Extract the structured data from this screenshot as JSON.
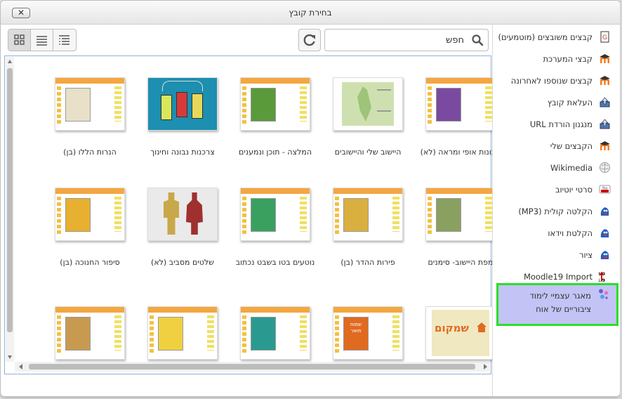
{
  "dialog": {
    "title": "בחירת קובץ",
    "close_label": "✕"
  },
  "search": {
    "placeholder": "חפש",
    "value": ""
  },
  "view_modes": [
    "icons",
    "list",
    "tree"
  ],
  "sidebar": {
    "items": [
      {
        "label": "קבצים משובצים (מוטמעים)",
        "icon": "embedded-files-icon",
        "color": "#c0392b"
      },
      {
        "label": "קבצי המערכת",
        "icon": "moodle-icon",
        "color": "#f47b20"
      },
      {
        "label": "קבצים שנוספו לאחרונה",
        "icon": "moodle-icon",
        "color": "#f47b20"
      },
      {
        "label": "העלאת קובץ",
        "icon": "upload-icon",
        "color": "#4a7ab5"
      },
      {
        "label": "מנגנון הורדת URL",
        "icon": "url-download-icon",
        "color": "#4a7ab5"
      },
      {
        "label": "הקבצים שלי",
        "icon": "moodle-icon",
        "color": "#f47b20"
      },
      {
        "label": "Wikimedia",
        "icon": "wikimedia-icon",
        "color": "#888888"
      },
      {
        "label": "סרטי יוטיוב",
        "icon": "youtube-icon",
        "color": "#cc0000"
      },
      {
        "label": "הקלטה קולית (MP3)",
        "icon": "poodll-icon",
        "color": "#1f5fbf"
      },
      {
        "label": "הקלטת וידאו",
        "icon": "poodll-icon",
        "color": "#1f5fbf"
      },
      {
        "label": "ציור",
        "icon": "poodll-icon",
        "color": "#1f5fbf"
      },
      {
        "label": "Moodle19 Import",
        "icon": "moodle19-import-icon",
        "color": "#cc0000"
      },
      {
        "label": "מאגר עצמיי לימוד ציבוריים של אוח",
        "icon": "repository-icon",
        "color": "#6b5bd6",
        "active": true
      }
    ]
  },
  "files": [
    {
      "name": "תבונות אופי ומראה (לא)",
      "thumb": "book-purple",
      "bg": "#7a4aa0"
    },
    {
      "name": "היישוב שלי והיישובים",
      "thumb": "map",
      "bg": "#cfe0b0"
    },
    {
      "name": "המלצה - תוכן ונמענים",
      "thumb": "book-green",
      "bg": "#5a9a3a"
    },
    {
      "name": "צרכנות נבונה וחינוך",
      "thumb": "tags",
      "bg": "#1d8fb0"
    },
    {
      "name": "הנרות הללו (בן)",
      "thumb": "book-candles",
      "bg": "#e8e0c8"
    },
    {
      "name": "מפת היישוב- סימנים",
      "thumb": "book-landscape",
      "bg": "#8aa060"
    },
    {
      "name": "פירות ההדר (בן)",
      "thumb": "book-tree",
      "bg": "#d9b040"
    },
    {
      "name": "נוטעים בטו בשבט נכתוב",
      "thumb": "book-sapling",
      "bg": "#3aa060"
    },
    {
      "name": "שלטים מסביב (לא)",
      "thumb": "figures",
      "bg": "#a03030"
    },
    {
      "name": "סיפור החנוכה (בן)",
      "thumb": "book-menorah",
      "bg": "#e8b030"
    },
    {
      "name": "",
      "thumb": "logo",
      "bg": "#f0e8c0",
      "text": "שמקום"
    },
    {
      "name": "",
      "thumb": "book-orange",
      "bg": "#e06a20",
      "text": "שמות תואר"
    },
    {
      "name": "",
      "thumb": "book-teal",
      "bg": "#2a9a90"
    },
    {
      "name": "",
      "thumb": "book-yellow",
      "bg": "#f0d040"
    },
    {
      "name": "",
      "thumb": "book-brown",
      "bg": "#c89a50"
    }
  ]
}
